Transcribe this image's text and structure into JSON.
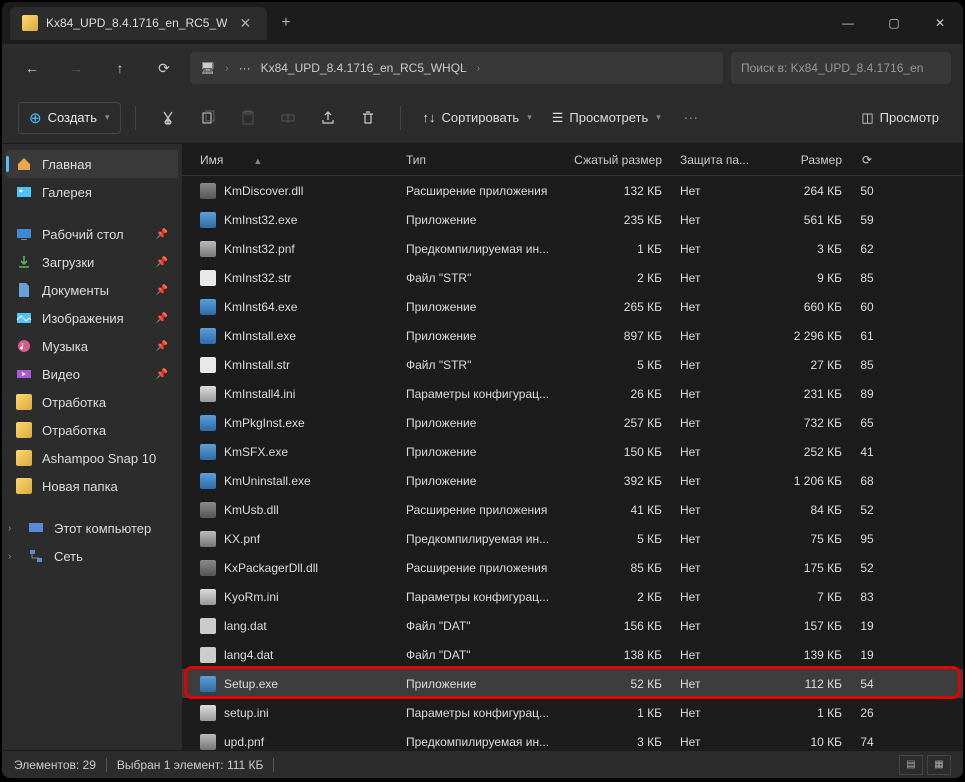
{
  "tab": {
    "title": "Kx84_UPD_8.4.1716_en_RC5_W"
  },
  "address": {
    "crumb": "Kx84_UPD_8.4.1716_en_RC5_WHQL",
    "ellipsis": "···"
  },
  "search": {
    "placeholder": "Поиск в: Kx84_UPD_8.4.1716_en"
  },
  "toolbar": {
    "new": "Создать",
    "sort": "Сортировать",
    "view": "Просмотреть",
    "preview": "Просмотр"
  },
  "sidebar": {
    "home": "Главная",
    "gallery": "Галерея",
    "desktop": "Рабочий стол",
    "downloads": "Загрузки",
    "documents": "Документы",
    "pictures": "Изображения",
    "music": "Музыка",
    "videos": "Видео",
    "f1": "Отработка",
    "f2": "Отработка",
    "f3": "Ashampoo Snap 10",
    "f4": "Новая папка",
    "thispc": "Этот компьютер",
    "network": "Сеть"
  },
  "columns": {
    "name": "Имя",
    "type": "Тип",
    "packed": "Сжатый размер",
    "prot": "Защита па...",
    "size": "Размер"
  },
  "files": [
    {
      "ico": "dll",
      "name": "KmDiscover.dll",
      "type": "Расширение приложения",
      "packed": "132 КБ",
      "prot": "Нет",
      "size": "264 КБ",
      "last": "50"
    },
    {
      "ico": "exe",
      "name": "KmInst32.exe",
      "type": "Приложение",
      "packed": "235 КБ",
      "prot": "Нет",
      "size": "561 КБ",
      "last": "59"
    },
    {
      "ico": "pnf",
      "name": "KmInst32.pnf",
      "type": "Предкомпилируемая ин...",
      "packed": "1 КБ",
      "prot": "Нет",
      "size": "3 КБ",
      "last": "62"
    },
    {
      "ico": "txt",
      "name": "KmInst32.str",
      "type": "Файл \"STR\"",
      "packed": "2 КБ",
      "prot": "Нет",
      "size": "9 КБ",
      "last": "85"
    },
    {
      "ico": "exe",
      "name": "KmInst64.exe",
      "type": "Приложение",
      "packed": "265 КБ",
      "prot": "Нет",
      "size": "660 КБ",
      "last": "60"
    },
    {
      "ico": "exe",
      "name": "KmInstall.exe",
      "type": "Приложение",
      "packed": "897 КБ",
      "prot": "Нет",
      "size": "2 296 КБ",
      "last": "61"
    },
    {
      "ico": "txt",
      "name": "KmInstall.str",
      "type": "Файл \"STR\"",
      "packed": "5 КБ",
      "prot": "Нет",
      "size": "27 КБ",
      "last": "85"
    },
    {
      "ico": "ini",
      "name": "KmInstall4.ini",
      "type": "Параметры конфигурац...",
      "packed": "26 КБ",
      "prot": "Нет",
      "size": "231 КБ",
      "last": "89"
    },
    {
      "ico": "exe",
      "name": "KmPkgInst.exe",
      "type": "Приложение",
      "packed": "257 КБ",
      "prot": "Нет",
      "size": "732 КБ",
      "last": "65"
    },
    {
      "ico": "exe",
      "name": "KmSFX.exe",
      "type": "Приложение",
      "packed": "150 КБ",
      "prot": "Нет",
      "size": "252 КБ",
      "last": "41"
    },
    {
      "ico": "exe",
      "name": "KmUninstall.exe",
      "type": "Приложение",
      "packed": "392 КБ",
      "prot": "Нет",
      "size": "1 206 КБ",
      "last": "68"
    },
    {
      "ico": "dll",
      "name": "KmUsb.dll",
      "type": "Расширение приложения",
      "packed": "41 КБ",
      "prot": "Нет",
      "size": "84 КБ",
      "last": "52"
    },
    {
      "ico": "pnf",
      "name": "KX.pnf",
      "type": "Предкомпилируемая ин...",
      "packed": "5 КБ",
      "prot": "Нет",
      "size": "75 КБ",
      "last": "95"
    },
    {
      "ico": "dll",
      "name": "KxPackagerDll.dll",
      "type": "Расширение приложения",
      "packed": "85 КБ",
      "prot": "Нет",
      "size": "175 КБ",
      "last": "52"
    },
    {
      "ico": "ini",
      "name": "KyoRm.ini",
      "type": "Параметры конфигурац...",
      "packed": "2 КБ",
      "prot": "Нет",
      "size": "7 КБ",
      "last": "83"
    },
    {
      "ico": "dat",
      "name": "lang.dat",
      "type": "Файл \"DAT\"",
      "packed": "156 КБ",
      "prot": "Нет",
      "size": "157 КБ",
      "last": "19"
    },
    {
      "ico": "dat",
      "name": "lang4.dat",
      "type": "Файл \"DAT\"",
      "packed": "138 КБ",
      "prot": "Нет",
      "size": "139 КБ",
      "last": "19"
    },
    {
      "ico": "exe",
      "name": "Setup.exe",
      "type": "Приложение",
      "packed": "52 КБ",
      "prot": "Нет",
      "size": "112 КБ",
      "last": "54",
      "selected": true
    },
    {
      "ico": "ini",
      "name": "setup.ini",
      "type": "Параметры конфигурац...",
      "packed": "1 КБ",
      "prot": "Нет",
      "size": "1 КБ",
      "last": "26"
    },
    {
      "ico": "pnf",
      "name": "upd.pnf",
      "type": "Предкомпилируемая ин...",
      "packed": "3 КБ",
      "prot": "Нет",
      "size": "10 КБ",
      "last": "74"
    }
  ],
  "status": {
    "count": "Элементов: 29",
    "sel": "Выбран 1 элемент: 111 КБ"
  }
}
